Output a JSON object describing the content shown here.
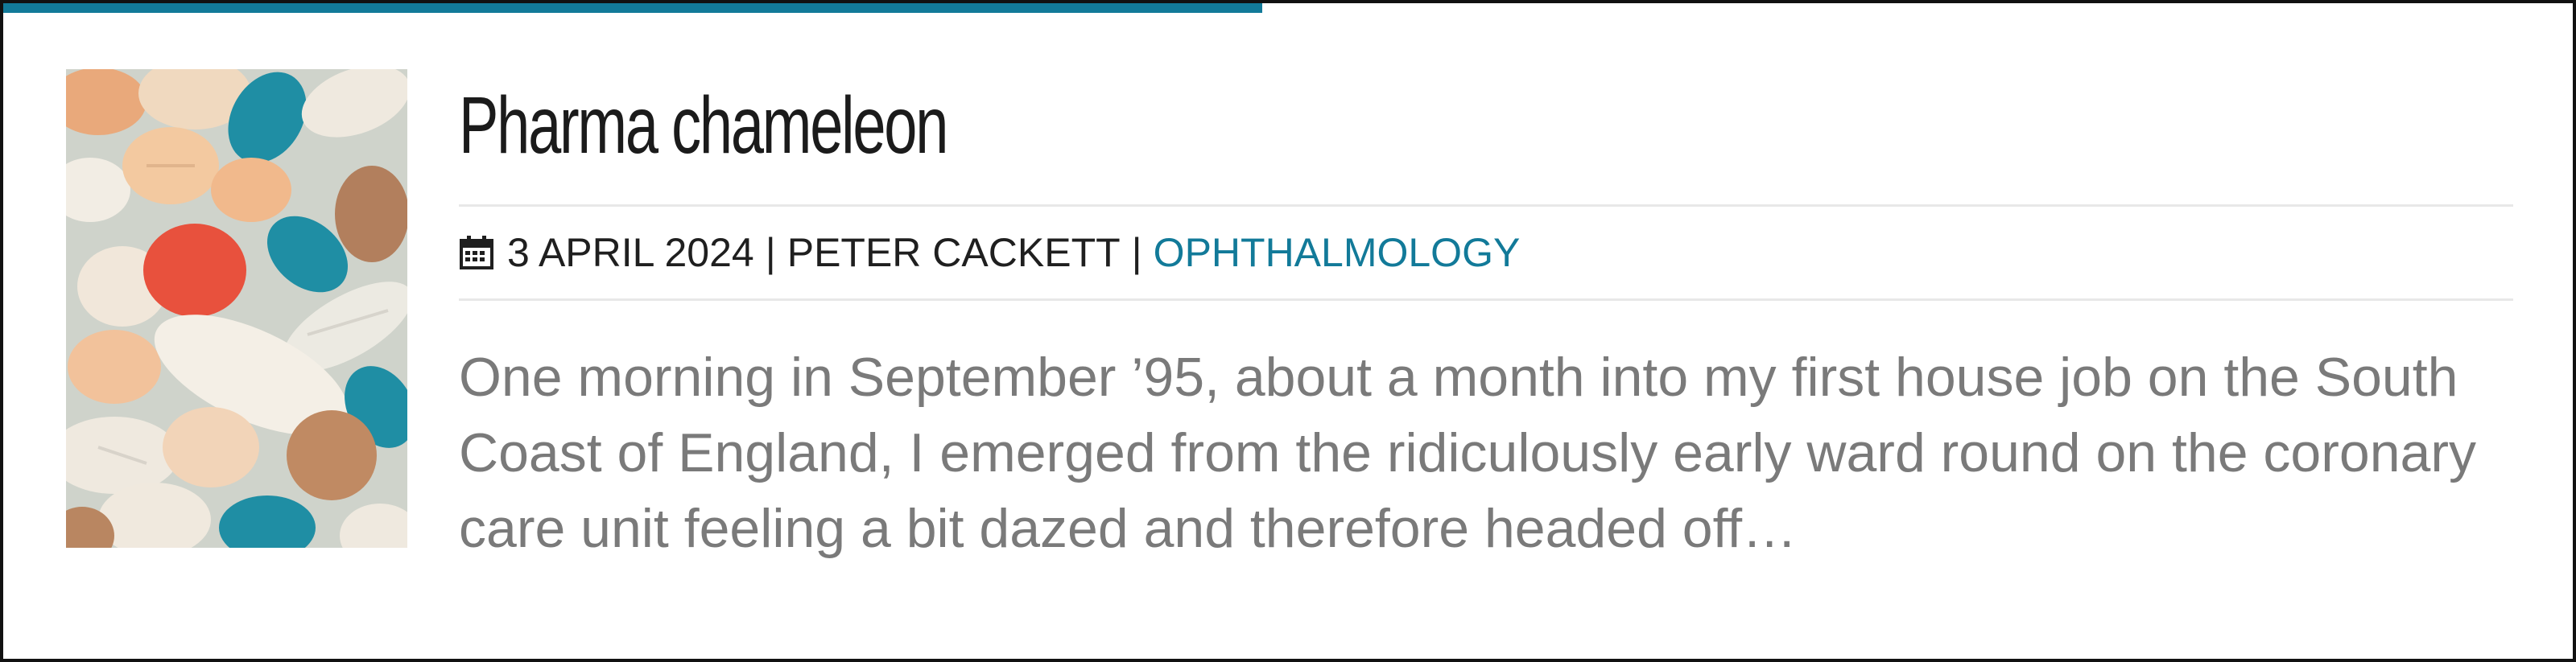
{
  "progress": {
    "percent": 49,
    "color": "#127a99"
  },
  "post": {
    "image_alt": "Assorted pills and tablets",
    "title": "Pharma chameleon",
    "date_icon": "calendar-icon",
    "date": "3 April 2024",
    "separator_1": "|",
    "author": "Peter Cackett",
    "separator_2": "|",
    "category": "Ophthalmology",
    "excerpt": "One morning in September ’95, about a month into my first house job on the South Coast of England, I emerged from the ridiculously early ward round on the coronary care unit feeling a bit dazed and therefore headed off…"
  },
  "colors": {
    "accent": "#127a99",
    "title": "#1b1b1b",
    "meta": "#1f1f1f",
    "excerpt": "#7a7a7a"
  }
}
